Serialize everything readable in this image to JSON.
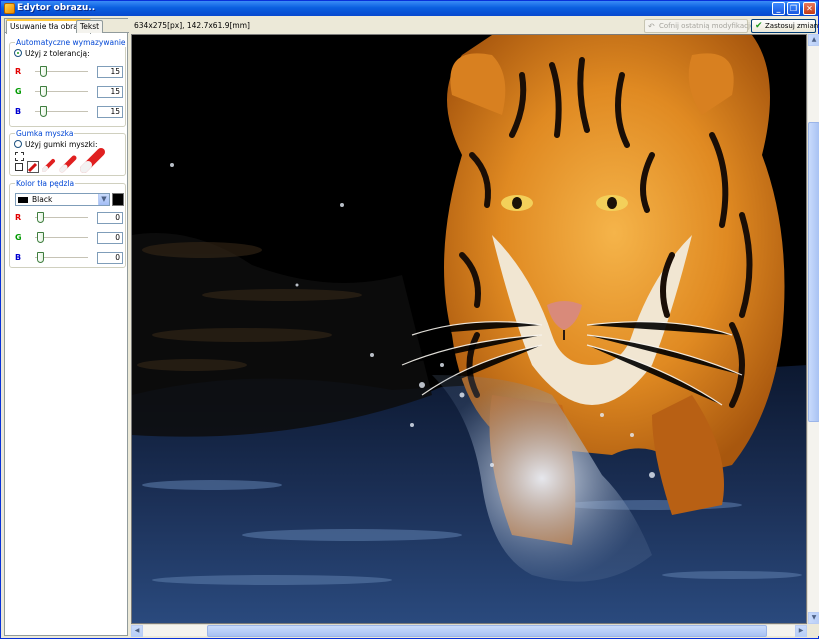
{
  "window": {
    "title": "Edytor obrazu..",
    "minimize_glyph": "_",
    "maximize_glyph": "❐",
    "close_glyph": "✕"
  },
  "tabs": [
    {
      "label": "Usuwanie tła obrazu",
      "active": true
    },
    {
      "label": "Tekst",
      "active": false
    }
  ],
  "auto_erase": {
    "title": "Automatyczne wymazywanie",
    "option_label": "Użyj z tolerancją:",
    "option_selected": true,
    "channels": [
      {
        "letter": "R",
        "value": "15",
        "level": 0.059
      },
      {
        "letter": "G",
        "value": "15",
        "level": 0.059
      },
      {
        "letter": "B",
        "value": "15",
        "level": 0.059
      }
    ]
  },
  "mouse_eraser": {
    "title": "Gumka myszka",
    "option_label": "Użyj gumki myszki:",
    "option_selected": false,
    "tool_icons": [
      "select-rect-icon",
      "eraser-small-icon",
      "eraser-medium-icon",
      "eraser-large-icon",
      "eraser-xlarge-icon"
    ]
  },
  "brush_color": {
    "title": "Kolor tła pędzla",
    "selected": "Black",
    "swatch": "#000000",
    "channels": [
      {
        "letter": "R",
        "value": "0",
        "level": 0
      },
      {
        "letter": "G",
        "value": "0",
        "level": 0
      },
      {
        "letter": "B",
        "value": "0",
        "level": 0
      }
    ]
  },
  "toolbar": {
    "size_info": "634x275[px], 142.7x61.9[mm]",
    "undo_label": "Cofnij ostatnią modyfikację",
    "undo_enabled": false,
    "apply_label": "Zastosuj zmiany"
  },
  "canvas": {
    "content": "tiger-photo",
    "background_removed_color": "#000000"
  },
  "colors": {
    "titlebar": "#0a5fe0",
    "group_title": "#0046d5",
    "channel_r": "#e10000",
    "channel_g": "#009a00",
    "channel_b": "#0000d0"
  }
}
